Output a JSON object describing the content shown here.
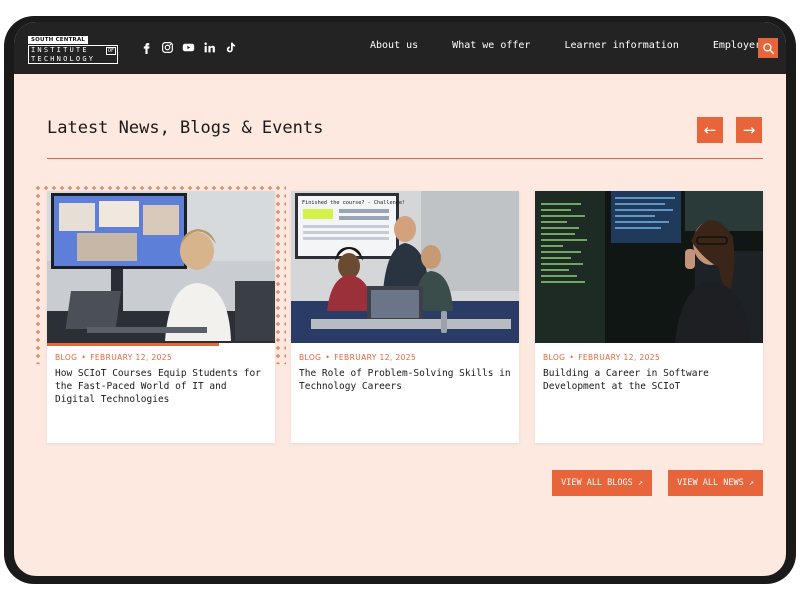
{
  "brand": {
    "small_label": "SOUTH CENTRAL",
    "name_line1": "INSTITUTE",
    "name_of": "OF",
    "name_line2": "TECHNOLOGY"
  },
  "socials": [
    "facebook-icon",
    "instagram-icon",
    "youtube-icon",
    "linkedin-icon",
    "tiktok-icon"
  ],
  "nav": {
    "items": [
      {
        "label": "About us"
      },
      {
        "label": "What we offer"
      },
      {
        "label": "Learner information"
      },
      {
        "label": "Employers"
      }
    ]
  },
  "section": {
    "title": "Latest News, Blogs & Events",
    "prev_arrow": "←",
    "next_arrow": "→"
  },
  "cards": [
    {
      "category": "BLOG",
      "separator": "•",
      "date": "FEBRUARY 12, 2025",
      "title": "How SCIoT Courses Equip Students for the Fast-Paced World of IT and Digital Technologies"
    },
    {
      "category": "BLOG",
      "separator": "•",
      "date": "FEBRUARY 12, 2025",
      "title": "The Role of Problem-Solving Skills in Technology Careers",
      "image_text": "Finished the course? - Challenge!"
    },
    {
      "category": "BLOG",
      "separator": "•",
      "date": "FEBRUARY 12, 2025",
      "title": "Building a Career in Software Development at the SCIoT"
    }
  ],
  "cta": {
    "view_blogs": "VIEW ALL BLOGS",
    "view_news": "VIEW ALL NEWS",
    "arrow": "↗"
  },
  "colors": {
    "accent": "#e8643a",
    "background": "#fde9df",
    "header": "#232323"
  }
}
